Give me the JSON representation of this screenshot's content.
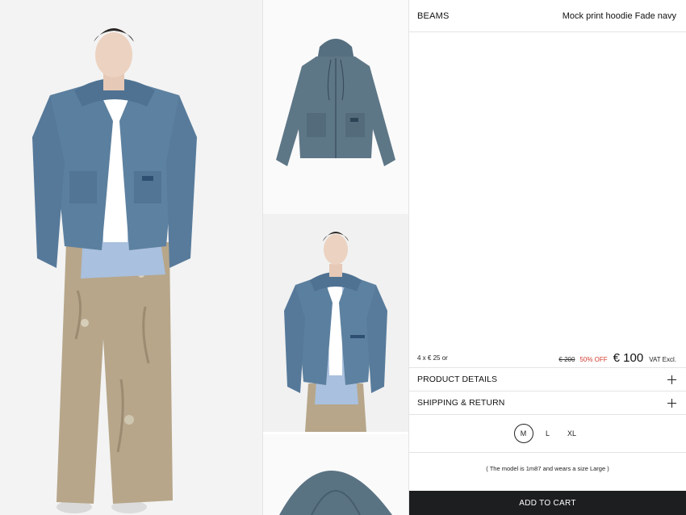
{
  "header": {
    "brand": "BEAMS",
    "product_name": "Mock print hoodie Fade navy"
  },
  "gallery": {
    "main_image": "model-full-body-photo",
    "thumbnails": [
      "hoodie-flat-lay-photo",
      "model-half-body-photo",
      "hoodie-detail-photo"
    ]
  },
  "pricing": {
    "installments": "4 x € 25 or",
    "old_price": "€ 200",
    "discount": "50% OFF",
    "price": "€ 100",
    "vat_note": "VAT Excl."
  },
  "accordions": [
    {
      "label": "PRODUCT DETAILS",
      "icon": "plus-icon"
    },
    {
      "label": "SHIPPING & RETURN",
      "icon": "plus-icon"
    }
  ],
  "sizes": {
    "options": [
      "M",
      "L",
      "XL"
    ],
    "selected": "M"
  },
  "model_note": "( The model is 1m87 and wears a size Large )",
  "cart_button": "ADD TO CART",
  "colors": {
    "discount": "#d23a2e",
    "button_bg": "#1d1e20",
    "denim": "#5b7f9e"
  }
}
